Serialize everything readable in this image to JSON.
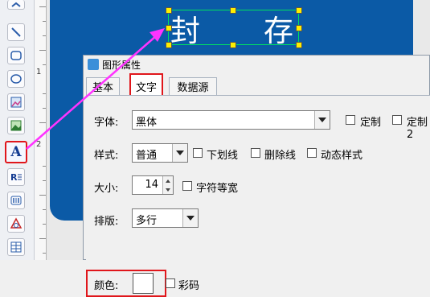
{
  "toolbar": {
    "tools": [
      {
        "icon": "line-icon"
      },
      {
        "icon": "rounded-rect-icon"
      },
      {
        "icon": "ellipse-icon"
      },
      {
        "icon": "image-icon"
      },
      {
        "icon": "picture-icon"
      },
      {
        "icon": "text-tool-icon",
        "glyph": "A"
      },
      {
        "icon": "rich-text-icon"
      },
      {
        "icon": "barcode-icon"
      },
      {
        "icon": "triangle-shape-icon"
      },
      {
        "icon": "grid-table-icon"
      }
    ]
  },
  "ruler": {
    "numbers": [
      "1",
      "2"
    ]
  },
  "canvas": {
    "text_char1": "封",
    "text_char2": "存"
  },
  "dialog": {
    "title": "图形属性",
    "tabs": [
      "基本",
      "文字",
      "数据源"
    ],
    "active_tab": "文字",
    "font": {
      "label": "字体:",
      "value": "黑体",
      "custom_label": "定制",
      "custom2_label": "定制2"
    },
    "style": {
      "label": "样式:",
      "value": "普通",
      "underline_label": "下划线",
      "strike_label": "删除线",
      "dynamic_label": "动态样式"
    },
    "size": {
      "label": "大小:",
      "value": "14",
      "monospace_label": "字符等宽"
    },
    "layout": {
      "label": "排版:",
      "value": "多行"
    },
    "color": {
      "label": "颜色:",
      "swatch": "#ffffff",
      "colorful_label": "彩码"
    }
  },
  "colors": {
    "accent_red": "#e0161b",
    "arrow": "#ff33ff",
    "label_blue": "#0b5aa6"
  }
}
